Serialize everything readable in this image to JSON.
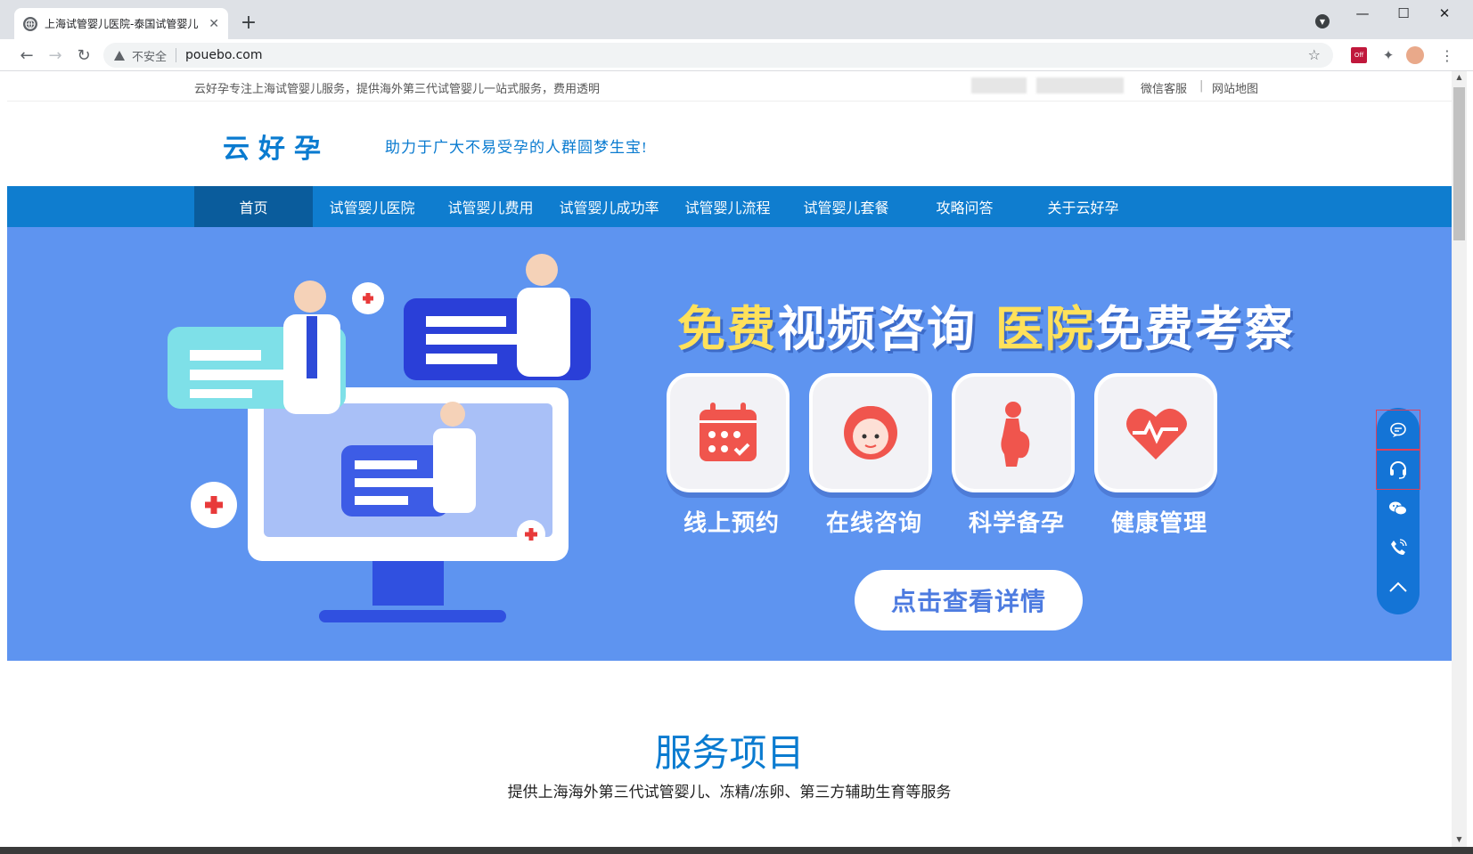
{
  "browser": {
    "tab_title": "上海试管婴儿医院-泰国试管婴儿",
    "url": "pouebo.com",
    "security_label": "不安全",
    "ext_label": "Off"
  },
  "site": {
    "topbar": {
      "intro": "云好孕专注上海试管婴儿服务，提供海外第三代试管婴儿一站式服务，费用透明",
      "links": [
        "微信客服",
        "网站地图"
      ],
      "separator": "|"
    },
    "logo": "云好孕",
    "slogan": "助力于广大不易受孕的人群圆梦生宝!",
    "nav": [
      "首页",
      "试管婴儿医院",
      "试管婴儿费用",
      "试管婴儿成功率",
      "试管婴儿流程",
      "试管婴儿套餐",
      "攻略问答",
      "关于云好孕"
    ],
    "banner": {
      "title_part1_hl": "免费",
      "title_part1": "视频咨询",
      "title_part2_hl": "医院",
      "title_part2": "免费考察",
      "features": [
        "线上预约",
        "在线咨询",
        "科学备孕",
        "健康管理"
      ],
      "cta": "点击查看详情"
    },
    "services": {
      "title": "服务项目",
      "subtitle": "提供上海海外第三代试管婴儿、冻精/冻卵、第三方辅助生育等服务"
    }
  },
  "colors": {
    "nav_bg": "#0f7dcf",
    "nav_active": "#0a5c9c",
    "banner_bg": "#5e94f0",
    "accent": "#0a7bd0",
    "highlight": "#ffe15a",
    "float_bar": "#1474d6"
  },
  "icons": {
    "float": [
      "chat-bubble-icon",
      "headset-icon",
      "wechat-icon",
      "phone-icon",
      "chevron-up-icon"
    ],
    "features": [
      "calendar-icon",
      "consultant-icon",
      "pregnant-icon",
      "heart-pulse-icon"
    ]
  }
}
